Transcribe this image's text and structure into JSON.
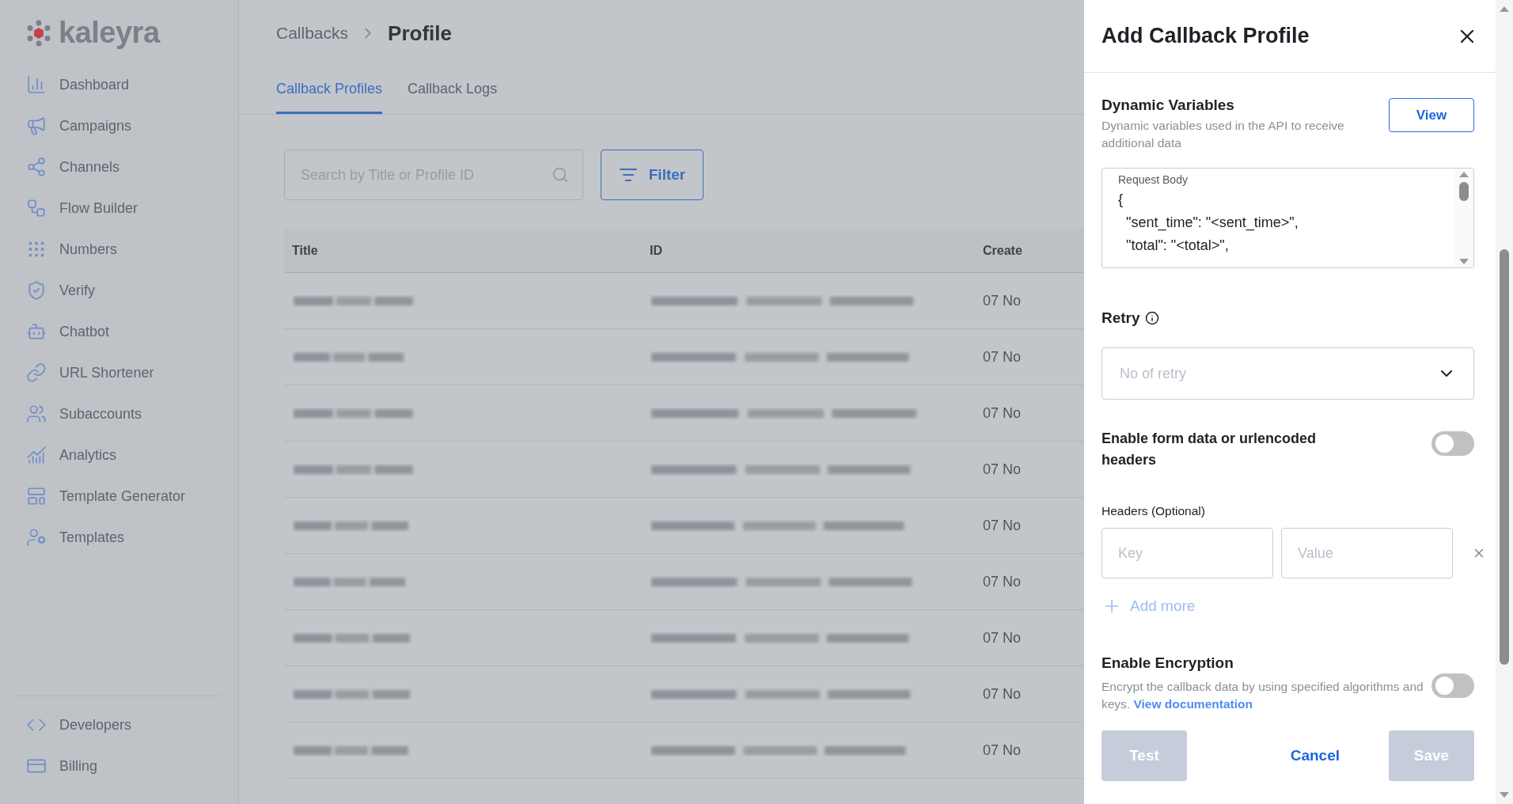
{
  "brand": {
    "name": "kaleyra"
  },
  "sidebar": {
    "items": [
      {
        "label": "Dashboard"
      },
      {
        "label": "Campaigns"
      },
      {
        "label": "Channels"
      },
      {
        "label": "Flow Builder"
      },
      {
        "label": "Numbers"
      },
      {
        "label": "Verify"
      },
      {
        "label": "Chatbot"
      },
      {
        "label": "URL Shortener"
      },
      {
        "label": "Subaccounts"
      },
      {
        "label": "Analytics"
      },
      {
        "label": "Template Generator"
      },
      {
        "label": "Templates"
      }
    ],
    "bottom_items": [
      {
        "label": "Developers"
      },
      {
        "label": "Billing"
      }
    ]
  },
  "breadcrumb": {
    "parent": "Callbacks",
    "current": "Profile"
  },
  "tabs": [
    {
      "label": "Callback Profiles",
      "selected": true
    },
    {
      "label": "Callback Logs",
      "selected": false
    }
  ],
  "search": {
    "placeholder": "Search by Title or Profile ID"
  },
  "filter_button": "Filter",
  "table": {
    "columns": [
      "Title",
      "ID",
      "Create"
    ],
    "rows": [
      {
        "created": "07 No"
      },
      {
        "created": "07 No"
      },
      {
        "created": "07 No"
      },
      {
        "created": "07 No"
      },
      {
        "created": "07 No"
      },
      {
        "created": "07 No"
      },
      {
        "created": "07 No"
      },
      {
        "created": "07 No"
      },
      {
        "created": "07 No"
      }
    ]
  },
  "panel": {
    "title": "Add Callback Profile",
    "dynamic_variables": {
      "title": "Dynamic Variables",
      "description": "Dynamic variables used in the API to receive additional data",
      "button": "View"
    },
    "request_body": {
      "label": "Request Body",
      "lines": [
        "{",
        "\"sent_time\": \"<sent_time>\",",
        "\"total\": \"<total>\","
      ]
    },
    "retry": {
      "label": "Retry",
      "placeholder": "No of retry"
    },
    "form_data_toggle": {
      "label": "Enable form data or urlencoded headers",
      "on": false
    },
    "headers": {
      "label": "Headers (Optional)",
      "key_placeholder": "Key",
      "value_placeholder": "Value",
      "add_more": "Add more"
    },
    "encryption": {
      "title": "Enable Encryption",
      "description": "Encrypt the callback data by using specified algorithms and keys.",
      "link": "View documentation",
      "on": false
    },
    "buttons": [
      {
        "label": "Test",
        "kind": "secondary",
        "disabled": true
      },
      {
        "label": "Cancel",
        "kind": "text",
        "disabled": false
      },
      {
        "label": "Save",
        "kind": "primary",
        "disabled": true
      }
    ]
  }
}
